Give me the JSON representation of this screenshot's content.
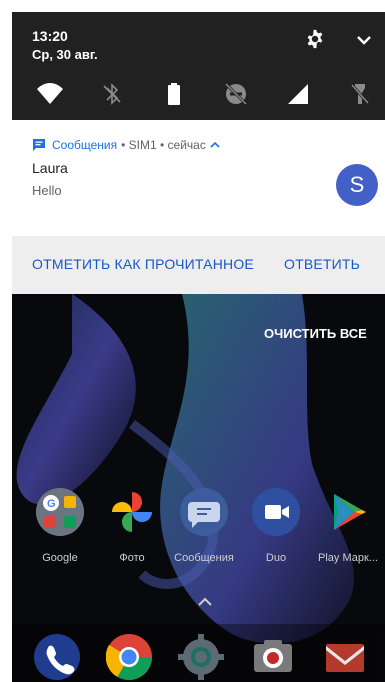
{
  "status": {
    "time": "13:20",
    "date": "Ср, 30 авг."
  },
  "quick_tiles": [
    "wifi-icon",
    "bluetooth-off-icon",
    "battery-icon",
    "dnd-off-icon",
    "signal-icon",
    "flashlight-off-icon"
  ],
  "notification": {
    "app_name": "Сообщения",
    "meta": "• SIM1 • сейчас",
    "title": "Laura",
    "body": "Hello",
    "avatar_letter": "S",
    "actions": {
      "mark_read": "ОТМЕТИТЬ КАК ПРОЧИТАННОЕ",
      "reply": "ОТВЕТИТЬ"
    }
  },
  "clear_all": "ОЧИСТИТЬ ВСЕ",
  "apps": [
    {
      "label": "Google",
      "icon": "google-folder-icon"
    },
    {
      "label": "Фото",
      "icon": "photos-icon"
    },
    {
      "label": "Сообщения",
      "icon": "messages-icon"
    },
    {
      "label": "Duo",
      "icon": "duo-icon"
    },
    {
      "label": "Play Марк...",
      "icon": "play-store-icon"
    }
  ],
  "dock": [
    "phone-icon",
    "chrome-icon",
    "settings-icon",
    "camera-icon",
    "gmail-icon"
  ],
  "colors": {
    "accent": "#1a73e8",
    "avatar": "#4360c7",
    "shade": "#212121"
  }
}
